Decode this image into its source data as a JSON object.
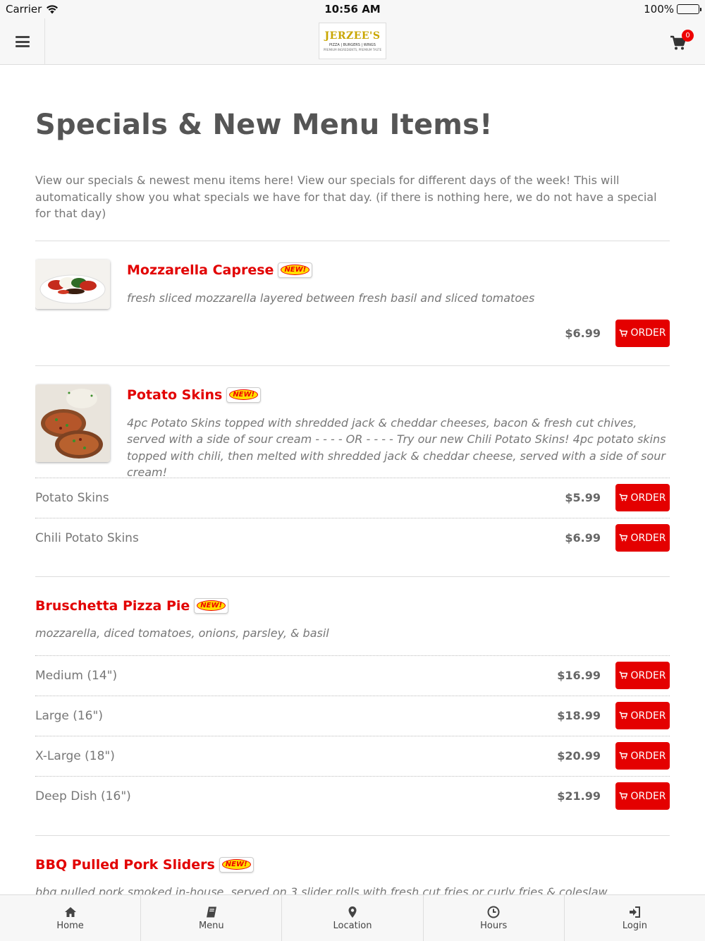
{
  "status_bar": {
    "carrier": "Carrier",
    "time": "10:56 AM",
    "battery": "100%"
  },
  "header": {
    "logo_brand": "JERZEE'S",
    "logo_tagline": "PIZZA | BURGERS | WINGS",
    "logo_subline": "PREMIUM INGREDIENTS, PREMIUM TASTE",
    "cart_count": "0"
  },
  "page": {
    "title": "Specials & New Menu Items!",
    "intro": "View our specials & newest menu items here! View our specials for different days of the week! This will automatically show you what specials we have for that day. (if there is nothing here, we do not have a special for that day)"
  },
  "new_badge": "NEW!",
  "order_label": "ORDER",
  "items": [
    {
      "name": "Mozzarella Caprese",
      "description": "fresh sliced mozzarella layered between fresh basil and sliced tomatoes",
      "options": [
        {
          "label": "",
          "price": "$6.99"
        }
      ]
    },
    {
      "name": "Potato Skins",
      "description": "4pc Potato Skins topped with shredded jack & cheddar cheeses, bacon & fresh cut chives, served with a side of sour cream - - - - OR - - - - Try our new Chili Potato Skins! 4pc potato skins topped with chili, then melted with shredded jack & cheddar cheese, served with a side of sour cream!",
      "options": [
        {
          "label": "Potato Skins",
          "price": "$5.99"
        },
        {
          "label": "Chili Potato Skins",
          "price": "$6.99"
        }
      ]
    },
    {
      "name": "Bruschetta Pizza Pie",
      "description": "mozzarella, diced tomatoes, onions, parsley, & basil",
      "options": [
        {
          "label": "Medium (14\")",
          "price": "$16.99"
        },
        {
          "label": "Large (16\")",
          "price": "$18.99"
        },
        {
          "label": "X-Large (18\")",
          "price": "$20.99"
        },
        {
          "label": "Deep Dish (16\")",
          "price": "$21.99"
        }
      ]
    },
    {
      "name": "BBQ Pulled Pork Sliders",
      "description": "bbq pulled pork smoked in-house, served on 3 slider rolls with fresh cut fries or curly fries & coleslaw"
    }
  ],
  "bottom_nav": [
    {
      "label": "Home",
      "icon": "home-icon"
    },
    {
      "label": "Menu",
      "icon": "book-icon"
    },
    {
      "label": "Location",
      "icon": "map-pin-icon"
    },
    {
      "label": "Hours",
      "icon": "clock-icon"
    },
    {
      "label": "Login",
      "icon": "sign-in-icon"
    }
  ]
}
